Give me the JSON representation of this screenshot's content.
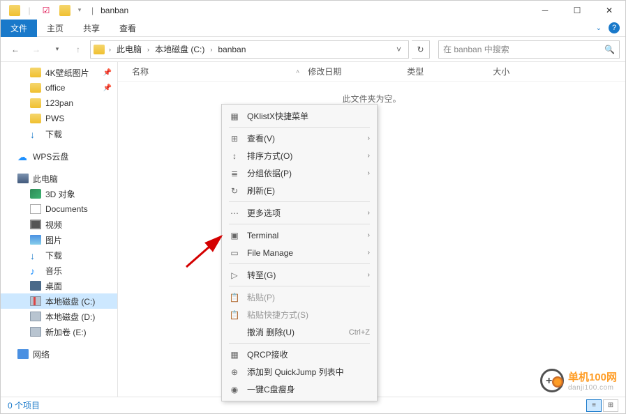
{
  "window": {
    "title": "banban"
  },
  "ribbon": {
    "file": "文件",
    "tabs": [
      "主页",
      "共享",
      "查看"
    ]
  },
  "breadcrumbs": [
    "此电脑",
    "本地磁盘 (C:)",
    "banban"
  ],
  "search": {
    "placeholder": "在 banban 中搜索"
  },
  "columns": {
    "name": "名称",
    "date": "修改日期",
    "type": "类型",
    "size": "大小"
  },
  "empty_message": "此文件夹为空。",
  "sidebar": {
    "quick": [
      {
        "label": "4K壁纸图片",
        "icon": "folder",
        "pinned": true
      },
      {
        "label": "office",
        "icon": "folder",
        "pinned": true
      },
      {
        "label": "123pan",
        "icon": "folder"
      },
      {
        "label": "PWS",
        "icon": "folder"
      },
      {
        "label": "下载",
        "icon": "dl"
      }
    ],
    "wps": "WPS云盘",
    "thispc": "此电脑",
    "pc_items": [
      {
        "label": "3D 对象",
        "icon": "obj3d"
      },
      {
        "label": "Documents",
        "icon": "doc"
      },
      {
        "label": "视频",
        "icon": "video"
      },
      {
        "label": "图片",
        "icon": "pic"
      },
      {
        "label": "下载",
        "icon": "dl"
      },
      {
        "label": "音乐",
        "icon": "music"
      },
      {
        "label": "桌面",
        "icon": "desk"
      },
      {
        "label": "本地磁盘 (C:)",
        "icon": "diskred",
        "selected": true
      },
      {
        "label": "本地磁盘 (D:)",
        "icon": "disk"
      },
      {
        "label": "新加卷 (E:)",
        "icon": "disk"
      }
    ],
    "network": "网络"
  },
  "context_menu": [
    {
      "label": "QKlistX快捷菜单",
      "icon": "▦"
    },
    {
      "sep": true
    },
    {
      "label": "查看(V)",
      "icon": "⊞",
      "sub": true
    },
    {
      "label": "排序方式(O)",
      "icon": "↕",
      "sub": true
    },
    {
      "label": "分组依据(P)",
      "icon": "≣",
      "sub": true
    },
    {
      "label": "刷新(E)",
      "icon": "↻"
    },
    {
      "sep": true
    },
    {
      "label": "更多选项",
      "icon": "⋯",
      "sub": true
    },
    {
      "sep": true
    },
    {
      "label": "Terminal",
      "icon": "▣",
      "sub": true
    },
    {
      "label": "File Manage",
      "icon": "▭",
      "sub": true
    },
    {
      "sep": true
    },
    {
      "label": "转至(G)",
      "icon": "▷",
      "sub": true
    },
    {
      "sep": true
    },
    {
      "label": "粘贴(P)",
      "icon": "📋",
      "disabled": true
    },
    {
      "label": "粘贴快捷方式(S)",
      "icon": "📋",
      "disabled": true
    },
    {
      "label": "撤消 删除(U)",
      "shortcut": "Ctrl+Z"
    },
    {
      "sep": true
    },
    {
      "label": "QRCP接收",
      "icon": "▦"
    },
    {
      "label": "添加到 QuickJump 列表中",
      "icon": "⊕"
    },
    {
      "label": "一键C盘瘦身",
      "icon": "◉"
    }
  ],
  "status": {
    "items": "0 个项目"
  },
  "watermark": {
    "line1": "单机100网",
    "line2": "danji100.com"
  }
}
